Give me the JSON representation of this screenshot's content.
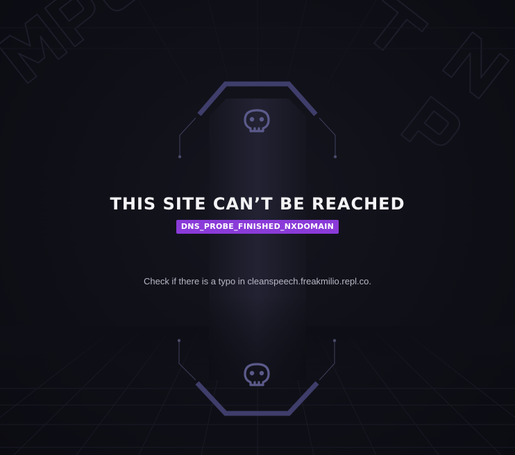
{
  "error": {
    "title": "THIS SITE CAN’T BE REACHED",
    "code": "DNS_PROBE_FINISHED_NXDOMAIN",
    "hint": "Check if there is a typo in cleanspeech.freakmilio.repl.co."
  },
  "icons": {
    "top": "skull-icon",
    "bottom": "skull-icon"
  },
  "colors": {
    "background": "#0e0e16",
    "frame": "#3f3d6a",
    "badge": "#8a3bd8",
    "title": "#f4f4f6",
    "hint": "#b8b8c6"
  }
}
